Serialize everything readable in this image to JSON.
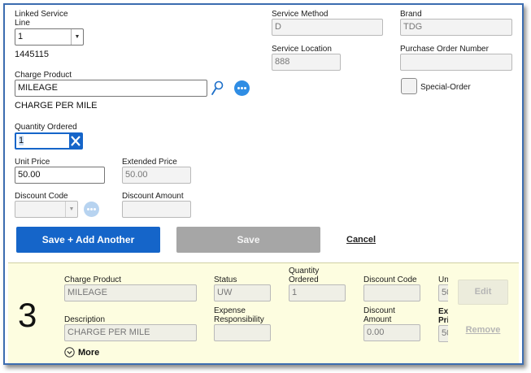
{
  "form": {
    "linked_service_line": {
      "label_line1": "Linked Service",
      "label_line2": "Line",
      "value": "1",
      "id_text": "1445115"
    },
    "service_method": {
      "label": "Service Method",
      "value": "D"
    },
    "brand": {
      "label": "Brand",
      "value": "TDG"
    },
    "service_location": {
      "label": "Service Location",
      "value": "888"
    },
    "purchase_order_number": {
      "label": "Purchase Order Number",
      "value": ""
    },
    "charge_product": {
      "label": "Charge Product",
      "value": "MILEAGE",
      "description": "CHARGE PER MILE"
    },
    "special_order": {
      "label": "Special-Order",
      "checked": false
    },
    "quantity_ordered": {
      "label": "Quantity Ordered",
      "value": "1"
    },
    "unit_price": {
      "label": "Unit Price",
      "value": "50.00"
    },
    "extended_price": {
      "label": "Extended Price",
      "value": "50.00"
    },
    "discount_code": {
      "label": "Discount Code",
      "value": ""
    },
    "discount_amount": {
      "label": "Discount Amount",
      "value": ""
    }
  },
  "actions": {
    "save_add_another": "Save + Add Another",
    "save": "Save",
    "cancel": "Cancel"
  },
  "line_card": {
    "number": "3",
    "charge_product": {
      "label": "Charge Product",
      "value": "MILEAGE"
    },
    "status": {
      "label": "Status",
      "value": "UW"
    },
    "quantity_ordered": {
      "label_line1": "Quantity",
      "label_line2": "Ordered",
      "value": "1"
    },
    "discount_code": {
      "label": "Discount Code",
      "value": ""
    },
    "unit_price_partial": {
      "label": "Uni",
      "value": "50"
    },
    "description": {
      "label": "Description",
      "value": "CHARGE PER MILE"
    },
    "expense_responsibility": {
      "label_line1": "Expense",
      "label_line2": "Responsibility",
      "value": ""
    },
    "discount_amount": {
      "label_line1": "Discount",
      "label_line2": "Amount",
      "value": "0.00"
    },
    "extended_price_partial": {
      "label_line1": "Ext",
      "label_line2": "Pri",
      "value": "50"
    },
    "edit": "Edit",
    "remove": "Remove",
    "more": "More"
  },
  "colors": {
    "primary": "#1565c9",
    "frame_border": "#3c6db0",
    "card_bg": "#fdfde0",
    "clear_button": "#1565c9",
    "action_circle": "#2f8de4"
  }
}
